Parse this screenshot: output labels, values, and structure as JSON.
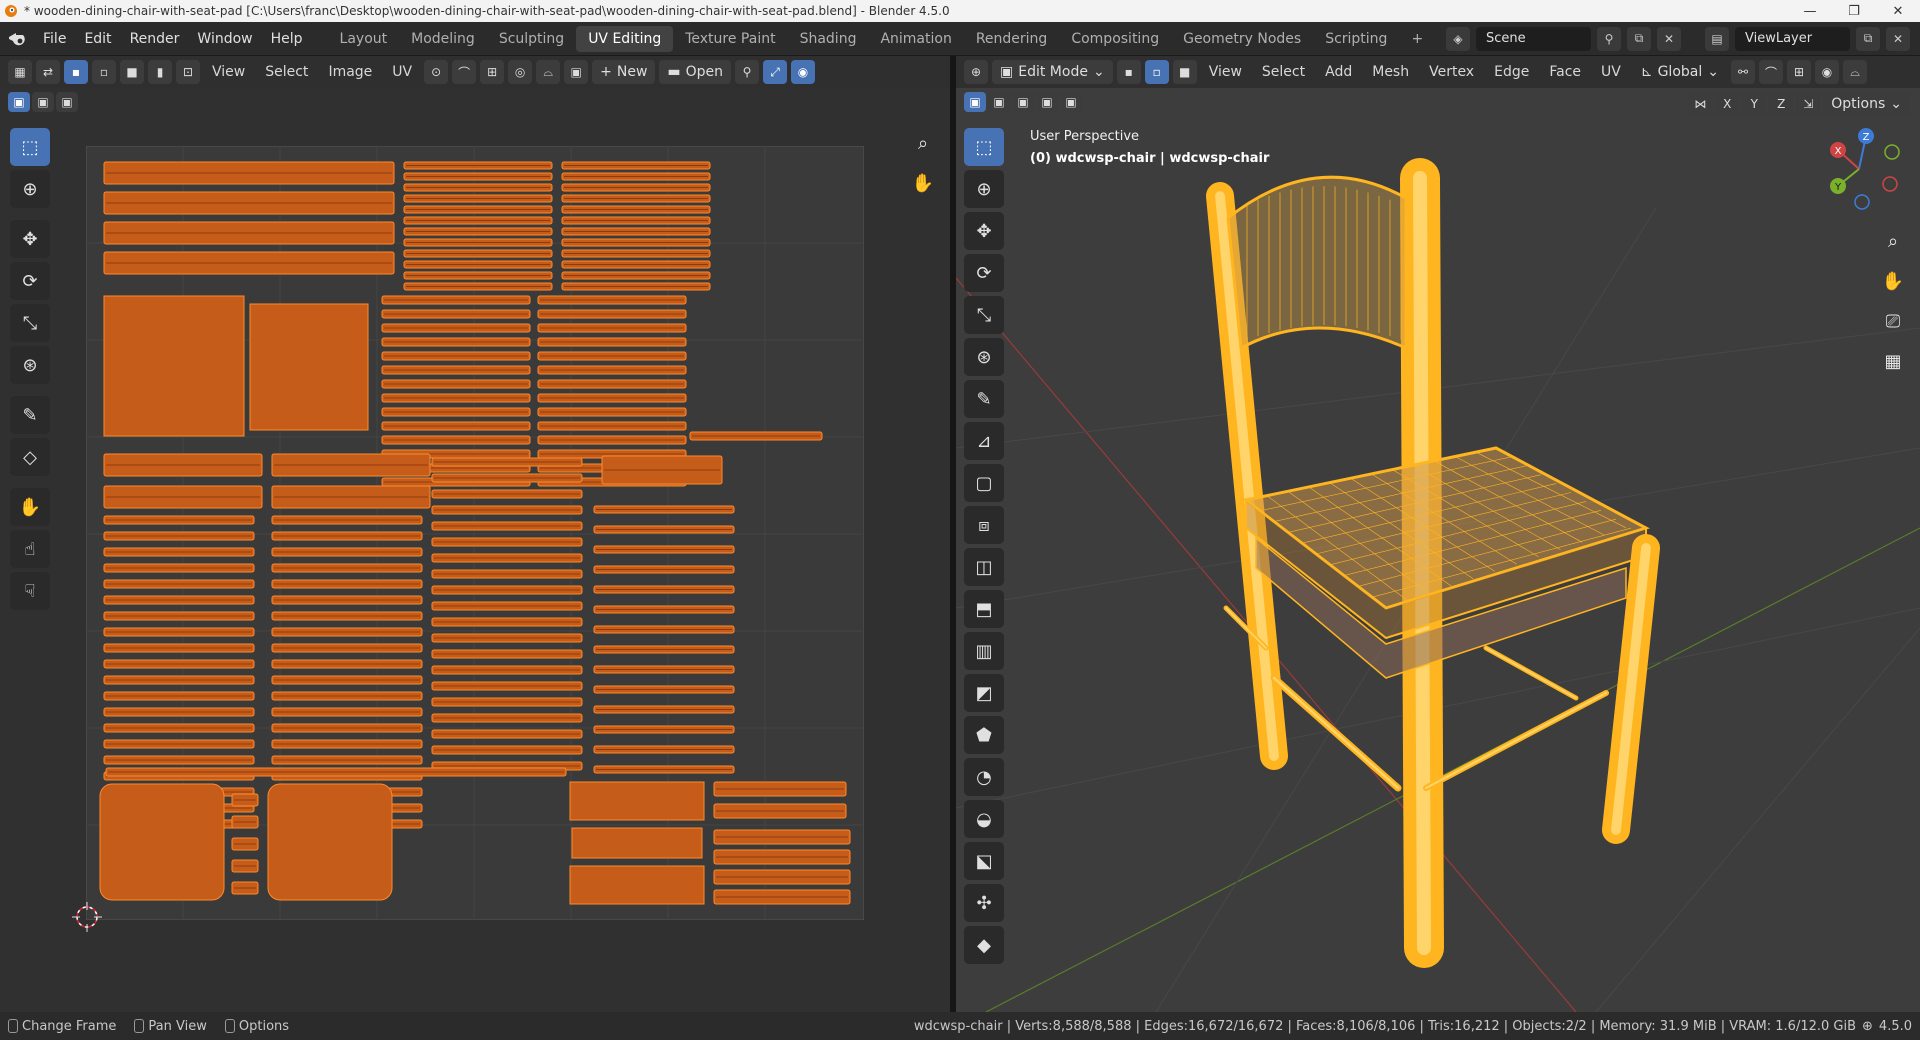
{
  "window": {
    "title": "* wooden-dining-chair-with-seat-pad [C:\\Users\\franc\\Desktop\\wooden-dining-chair-with-seat-pad\\wooden-dining-chair-with-seat-pad.blend] - Blender 4.5.0",
    "minimize": "—",
    "maximize": "❐",
    "close": "✕"
  },
  "menus": [
    "File",
    "Edit",
    "Render",
    "Window",
    "Help"
  ],
  "workspaces": [
    {
      "label": "Layout",
      "active": false
    },
    {
      "label": "Modeling",
      "active": false
    },
    {
      "label": "Sculpting",
      "active": false
    },
    {
      "label": "UV Editing",
      "active": true
    },
    {
      "label": "Texture Paint",
      "active": false
    },
    {
      "label": "Shading",
      "active": false
    },
    {
      "label": "Animation",
      "active": false
    },
    {
      "label": "Rendering",
      "active": false
    },
    {
      "label": "Compositing",
      "active": false
    },
    {
      "label": "Geometry Nodes",
      "active": false
    },
    {
      "label": "Scripting",
      "active": false
    }
  ],
  "add_workspace": "+",
  "scene": {
    "label": "Scene",
    "view_layer": "ViewLayer"
  },
  "uv_editor": {
    "menus": [
      "View",
      "Select",
      "Image",
      "UV"
    ],
    "new_label": "New",
    "open_label": "Open",
    "plus": "+"
  },
  "viewport": {
    "mode": "Edit Mode",
    "menus": [
      "View",
      "Select",
      "Add",
      "Mesh",
      "Vertex",
      "Edge",
      "Face",
      "UV"
    ],
    "orientation": "Global",
    "axes": [
      "X",
      "Y",
      "Z"
    ],
    "options_label": "Options",
    "perspective": "User Perspective",
    "object_info": "(0) wdcwsp-chair | wdcwsp-chair",
    "gizmo": {
      "x": "X",
      "y": "Y",
      "z": "Z"
    }
  },
  "status": {
    "change_frame": "Change Frame",
    "pan_view": "Pan View",
    "options": "Options",
    "stats": "wdcwsp-chair | Verts:8,588/8,588 | Edges:16,672/16,672 | Faces:8,106/8,106 | Tris:16,212 | Objects:2/2 | Memory: 31.9 MiB | VRAM: 1.6/12.0 GiB",
    "version": "4.5.0"
  },
  "colors": {
    "accent": "#4772b3",
    "uv_fill": "#c65c1a",
    "uv_edge": "#ff8a2a",
    "wire": "#ffb51f",
    "x_axis": "#c83b3b",
    "y_axis": "#6a9a2a"
  }
}
